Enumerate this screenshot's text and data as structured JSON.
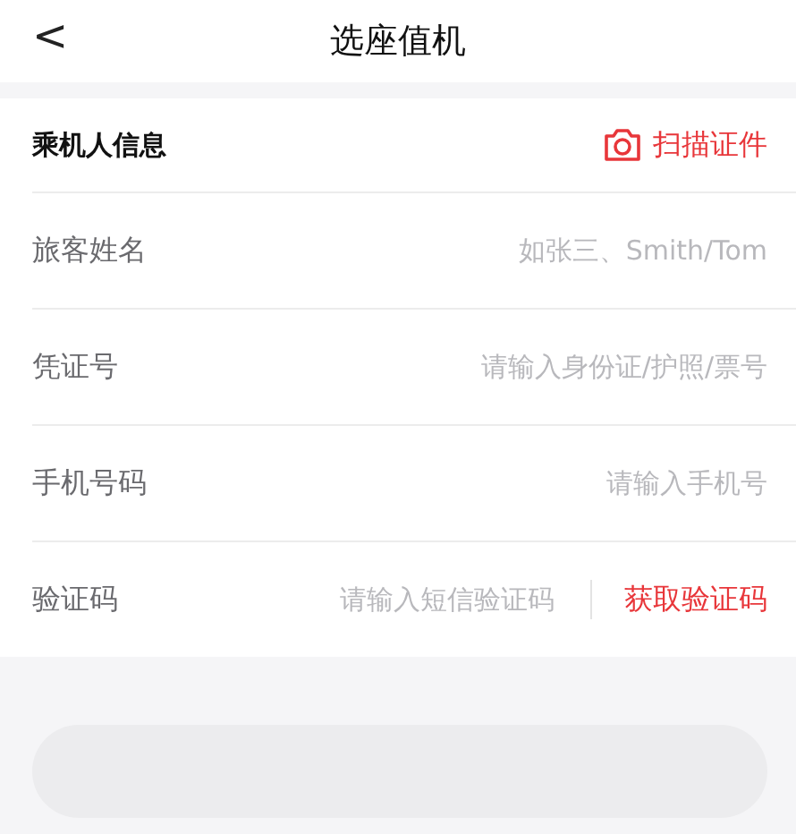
{
  "header": {
    "back": "<",
    "title": "选座值机"
  },
  "section": {
    "title": "乘机人信息",
    "scan_label": "扫描证件"
  },
  "fields": [
    {
      "kind": "text",
      "label": "旅客姓名",
      "placeholder": "如张三、Smith/Tom"
    },
    {
      "kind": "text",
      "label": "凭证号",
      "placeholder": "请输入身份证/护照/票号"
    },
    {
      "kind": "text",
      "label": "手机号码",
      "placeholder": "请输入手机号"
    },
    {
      "kind": "code",
      "label": "验证码",
      "placeholder": "请输入短信验证码",
      "action": "获取验证码"
    }
  ],
  "submit": {
    "disabled": true
  }
}
